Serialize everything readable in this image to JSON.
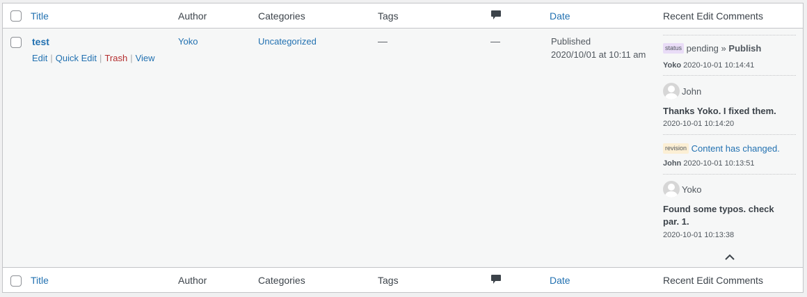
{
  "columns": {
    "title": "Title",
    "author": "Author",
    "categories": "Categories",
    "tags": "Tags",
    "date": "Date",
    "recent_edit_comments": "Recent Edit Comments"
  },
  "row": {
    "title": "test",
    "actions": {
      "edit": "Edit",
      "quick_edit": "Quick Edit",
      "trash": "Trash",
      "view": "View",
      "separator": "|"
    },
    "author": "Yoko",
    "category": "Uncategorized",
    "tags": "—",
    "comments": "—",
    "date_status": "Published",
    "date_value": "2020/10/01 at 10:11 am"
  },
  "recent_comments": {
    "status_entry": {
      "badge": "status",
      "from": "pending",
      "arrow": "»",
      "to": "Publish",
      "user": "Yoko",
      "time": "2020-10-01 10:14:41"
    },
    "comment_1": {
      "user": "John",
      "text": "Thanks Yoko. I fixed them.",
      "time": "2020-10-01 10:14:20"
    },
    "revision_entry": {
      "badge": "revision",
      "text": "Content has changed.",
      "user": "John",
      "time": "2020-10-01 10:13:51"
    },
    "comment_2": {
      "user": "Yoko",
      "text": "Found some typos. check par. 1.",
      "time": "2020-10-01 10:13:38"
    }
  },
  "icons": {
    "comment_column": "comment-bubble-icon",
    "collapse": "chevron-up-icon"
  },
  "colors": {
    "link": "#2271b1",
    "trash": "#b32d2e",
    "status_badge": "#e9dcf7",
    "revision_badge": "#fcefd4"
  }
}
